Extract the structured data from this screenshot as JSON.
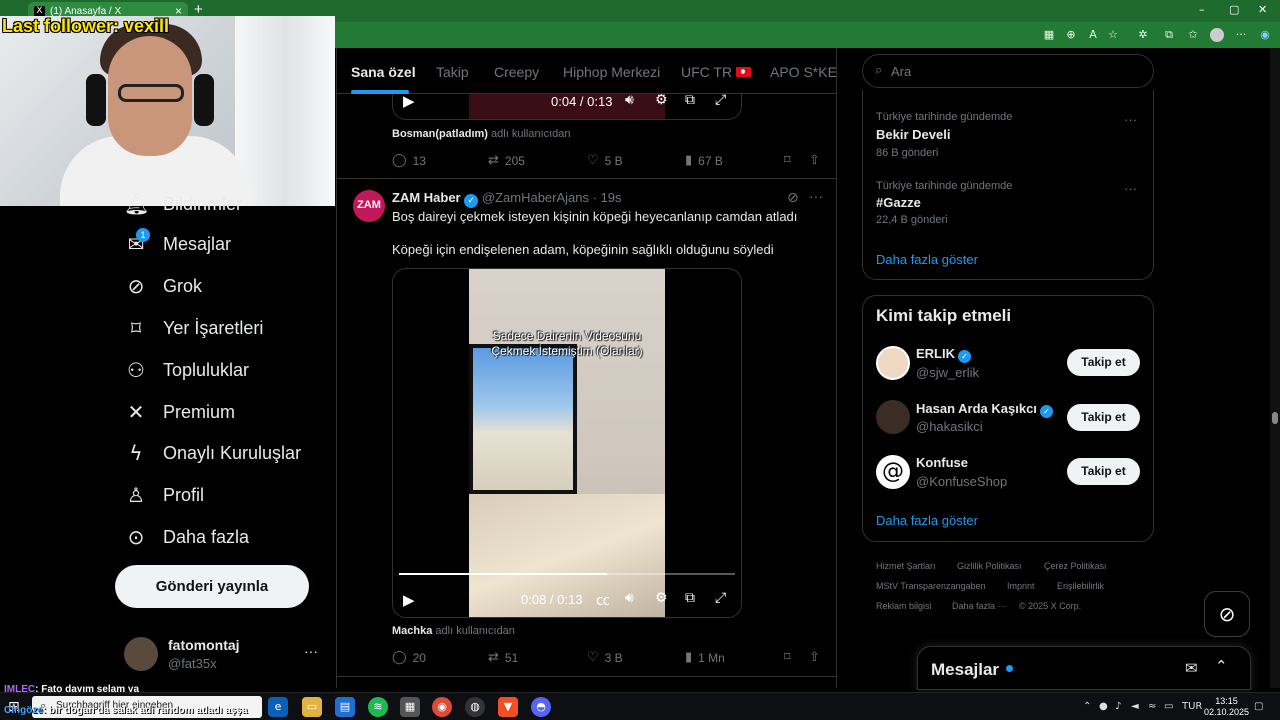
{
  "browser": {
    "tab_title": "(1) Anasayfa / X",
    "tab_close": "×",
    "new_tab": "+",
    "window_controls": [
      "–",
      "▢",
      "✕"
    ]
  },
  "stream": {
    "last_follower": "Last follower: vexill",
    "chat": [
      {
        "user": "IMLEC",
        "text": ": Fato dayım selam ya"
      },
      {
        "user": "Cingöze",
        "text": ": bir dogan da salak adi random atladı aşşa"
      }
    ]
  },
  "sidebar": {
    "items": [
      {
        "label": "Bildirimler",
        "icon": "bell-icon"
      },
      {
        "label": "Mesajlar",
        "icon": "envelope-icon",
        "badge": "1"
      },
      {
        "label": "Grok",
        "icon": "grok-icon"
      },
      {
        "label": "Yer İşaretleri",
        "icon": "bookmark-icon"
      },
      {
        "label": "Topluluklar",
        "icon": "people-icon"
      },
      {
        "label": "Premium",
        "icon": "x-logo-icon"
      },
      {
        "label": "Onaylı Kuruluşlar",
        "icon": "lightning-icon"
      },
      {
        "label": "Profil",
        "icon": "person-icon"
      },
      {
        "label": "Daha fazla",
        "icon": "more-circle-icon"
      }
    ],
    "post_button": "Gönderi yayınla",
    "account": {
      "name": "fatomontaj",
      "handle": "@fat35x",
      "more": "···"
    }
  },
  "feed": {
    "tabs": [
      "Sana özel",
      "Takip",
      "Creepy",
      "Hiphop Merkezi",
      "UFC TR",
      "APO S*KEN"
    ],
    "active_tab": 0,
    "post1": {
      "video_time": "0:04 / 0:13",
      "from_user": "Bosman(patladım)",
      "from_suffix": "adlı kullanıcıdan",
      "replies": "13",
      "reposts": "205",
      "likes": "5 B",
      "views": "67 B"
    },
    "post2": {
      "avatar_text": "ZAM",
      "name": "ZAM Haber",
      "handle": "@ZamHaberAjans",
      "time": "· 19s",
      "text1": "Boş daireyi çekmek isteyen kişinin köpeği heyecanlanıp camdan atladı",
      "text2": "Köpeği için endişelenen adam, köpeğinin sağlıklı olduğunu söyledi",
      "video_caption_line1": "Sadece Dairenin Videosunu",
      "video_caption_line2": "Çekmek İstemiştim (Olanlar)",
      "video_time": "0:08 / 0:13",
      "video_progress": 0.62,
      "from_user": "Machka",
      "from_suffix": "adlı kullanıcıdan",
      "replies": "20",
      "reposts": "51",
      "likes": "3 B",
      "views": "1 Mn"
    }
  },
  "right": {
    "search_placeholder": "Ara",
    "trends": [
      {
        "context": "Türkiye tarihinde gündemde",
        "name": "Bekir Develi",
        "count": "86 B gönderi"
      },
      {
        "context": "Türkiye tarihinde gündemde",
        "name": "#Gazze",
        "count": "22,4 B gönderi"
      }
    ],
    "trends_show_more": "Daha fazla göster",
    "who_to_follow": {
      "title": "Kimi takip etmeli",
      "accounts": [
        {
          "name": "ERLIK",
          "handle": "@sjw_erlik",
          "button": "Takip et"
        },
        {
          "name": "Hasan Arda Kaşıkcı",
          "handle": "@hakasikci",
          "button": "Takip et"
        },
        {
          "name": "Konfuse",
          "handle": "@KonfuseShop",
          "button": "Takip et"
        }
      ],
      "show_more": "Daha fazla göster"
    },
    "footer": [
      "Hizmet Şartları",
      "Gizlilik Politikası",
      "Çerez Politikası",
      "MStV Transparenzangaben",
      "Imprint",
      "Erişilebilirlik",
      "Reklam bilgisi",
      "Daha fazla ···",
      "© 2025 X Corp."
    ],
    "messages_drawer": "Mesajlar"
  },
  "taskbar": {
    "search_placeholder": "Surchbagriff hier eingeben",
    "lang": "TUR",
    "time": "13:15",
    "date": "02.10.2025"
  },
  "colors": {
    "accent": "#1d9bf0",
    "background": "#000000",
    "chrome": "#1f6b2e"
  }
}
